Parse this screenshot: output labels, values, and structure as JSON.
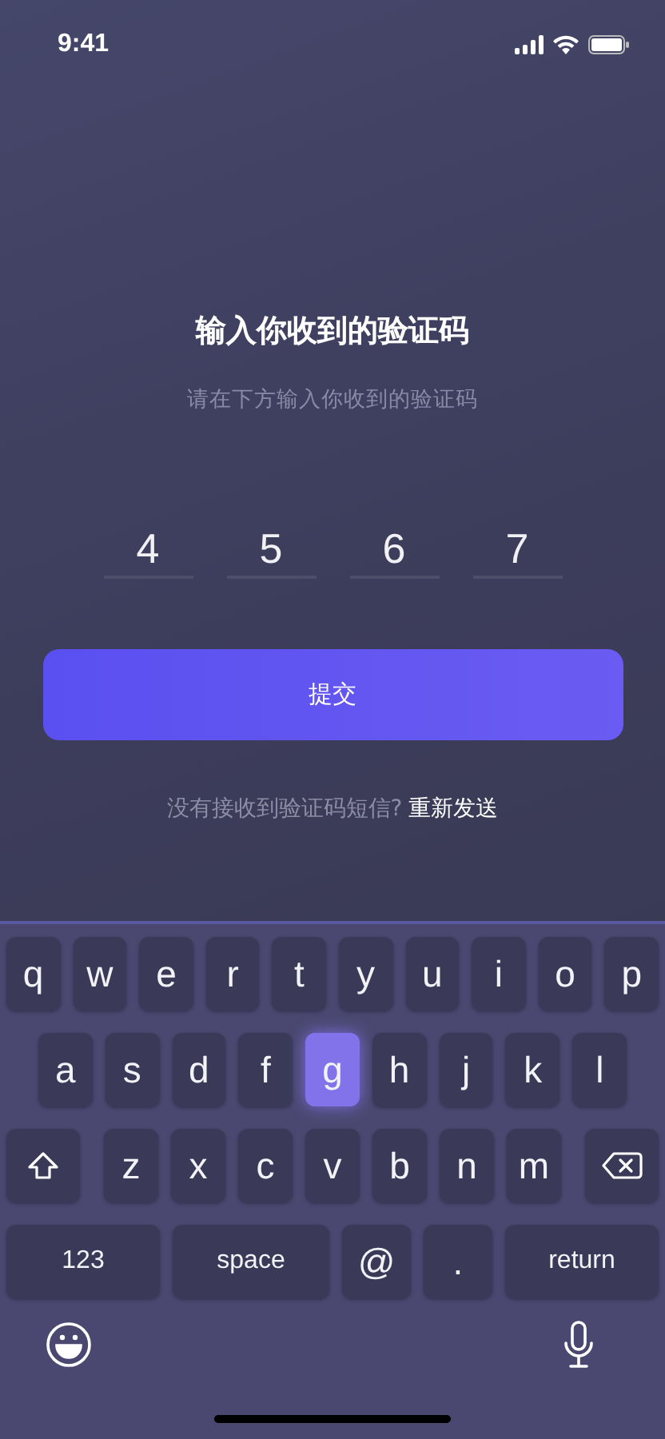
{
  "status_bar": {
    "time": "9:41"
  },
  "title": "输入你收到的验证码",
  "subtitle": "请在下方输入你收到的验证码",
  "code_digits": [
    "4",
    "5",
    "6",
    "7"
  ],
  "submit_button": "提交",
  "resend": {
    "prompt": "没有接收到验证码短信?",
    "link": "重新发送"
  },
  "keyboard": {
    "top_row": [
      {
        "kind": "char",
        "label": "q",
        "selected": false
      },
      {
        "kind": "char",
        "label": "w",
        "selected": false
      },
      {
        "kind": "char",
        "label": "e",
        "selected": false
      },
      {
        "kind": "char",
        "label": "r",
        "selected": false
      },
      {
        "kind": "char",
        "label": "t",
        "selected": false
      },
      {
        "kind": "char",
        "label": "y",
        "selected": false
      },
      {
        "kind": "char",
        "label": "u",
        "selected": false
      },
      {
        "kind": "char",
        "label": "i",
        "selected": false
      },
      {
        "kind": "char",
        "label": "o",
        "selected": false
      },
      {
        "kind": "char",
        "label": "p",
        "selected": false
      }
    ],
    "middle_row": [
      {
        "kind": "char",
        "label": "a",
        "selected": false
      },
      {
        "kind": "char",
        "label": "s",
        "selected": false
      },
      {
        "kind": "char",
        "label": "d",
        "selected": false
      },
      {
        "kind": "char",
        "label": "f",
        "selected": false
      },
      {
        "kind": "char",
        "label": "g",
        "selected": true
      },
      {
        "kind": "char",
        "label": "h",
        "selected": false
      },
      {
        "kind": "char",
        "label": "j",
        "selected": false
      },
      {
        "kind": "char",
        "label": "k",
        "selected": false
      },
      {
        "kind": "char",
        "label": "l",
        "selected": false
      }
    ],
    "lower_row": [
      {
        "kind": "shift",
        "selected": false
      },
      {
        "kind": "char",
        "label": "z",
        "selected": false
      },
      {
        "kind": "char",
        "label": "x",
        "selected": false
      },
      {
        "kind": "char",
        "label": "c",
        "selected": false
      },
      {
        "kind": "char",
        "label": "v",
        "selected": false
      },
      {
        "kind": "char",
        "label": "b",
        "selected": false
      },
      {
        "kind": "char",
        "label": "n",
        "selected": false
      },
      {
        "kind": "char",
        "label": "m",
        "selected": false
      },
      {
        "kind": "delete",
        "selected": false
      }
    ],
    "function_row": [
      {
        "kind": "wide",
        "label": "123",
        "selected": false
      },
      {
        "kind": "wide",
        "label": "space",
        "selected": false
      },
      {
        "kind": "char",
        "label": "@",
        "selected": false
      },
      {
        "kind": "char",
        "label": ".",
        "selected": false
      },
      {
        "kind": "wide",
        "label": "return",
        "selected": false
      }
    ]
  }
}
